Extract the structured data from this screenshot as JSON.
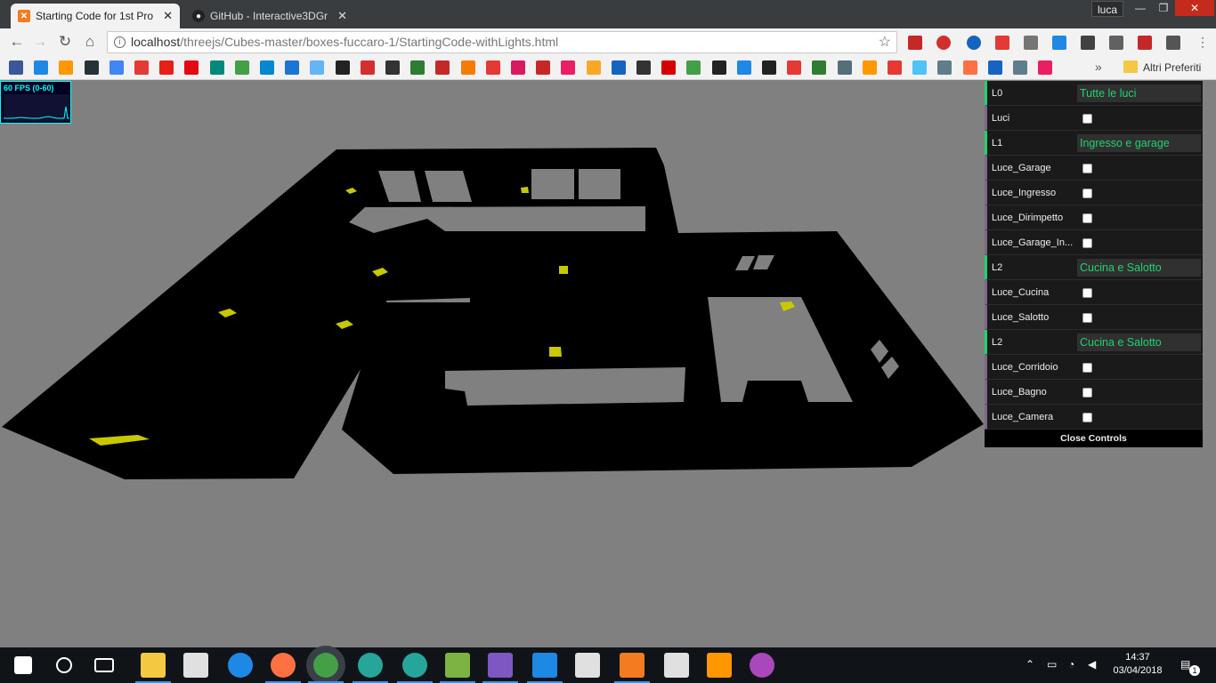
{
  "browser": {
    "tabs": [
      {
        "title": "Starting Code for 1st Pro",
        "favicon": "xampp-icon",
        "active": true
      },
      {
        "title": "GitHub - Interactive3DGr",
        "favicon": "github-icon",
        "active": false
      }
    ],
    "user": "luca",
    "url": {
      "host": "localhost",
      "path": "/threejs/Cubes-master/boxes-fuccaro-1/StartingCode-withLights.html"
    },
    "bookmarks_overflow": "»",
    "other_bookmarks": "Altri Preferiti"
  },
  "stats": {
    "fps_label": "60 FPS (0-60)"
  },
  "gui": {
    "rows": [
      {
        "type": "folder",
        "label": "L0",
        "value": "Tutte le luci"
      },
      {
        "type": "bool",
        "label": "Luci",
        "checked": false
      },
      {
        "type": "folder",
        "label": "L1",
        "value": "Ingresso e garage"
      },
      {
        "type": "bool",
        "label": "Luce_Garage",
        "checked": false
      },
      {
        "type": "bool",
        "label": "Luce_Ingresso",
        "checked": false
      },
      {
        "type": "bool",
        "label": "Luce_Dirimpetto",
        "checked": false
      },
      {
        "type": "bool",
        "label": "Luce_Garage_In...",
        "checked": false
      },
      {
        "type": "folder",
        "label": "L2",
        "value": "Cucina e Salotto"
      },
      {
        "type": "bool",
        "label": "Luce_Cucina",
        "checked": false
      },
      {
        "type": "bool",
        "label": "Luce_Salotto",
        "checked": false
      },
      {
        "type": "folder",
        "label": "L2",
        "value": "Cucina e Salotto"
      },
      {
        "type": "bool",
        "label": "Luce_Corridoio",
        "checked": false
      },
      {
        "type": "bool",
        "label": "Luce_Bagno",
        "checked": false
      },
      {
        "type": "bool",
        "label": "Luce_Camera",
        "checked": false
      }
    ],
    "close_label": "Close Controls"
  },
  "taskbar": {
    "time": "14:37",
    "date": "03/04/2018",
    "notification_count": "1"
  },
  "colors": {
    "background": "#808080",
    "floorplan": "#000000",
    "light_marker": "#c8c800",
    "gui_accent": "#1ed36f"
  }
}
